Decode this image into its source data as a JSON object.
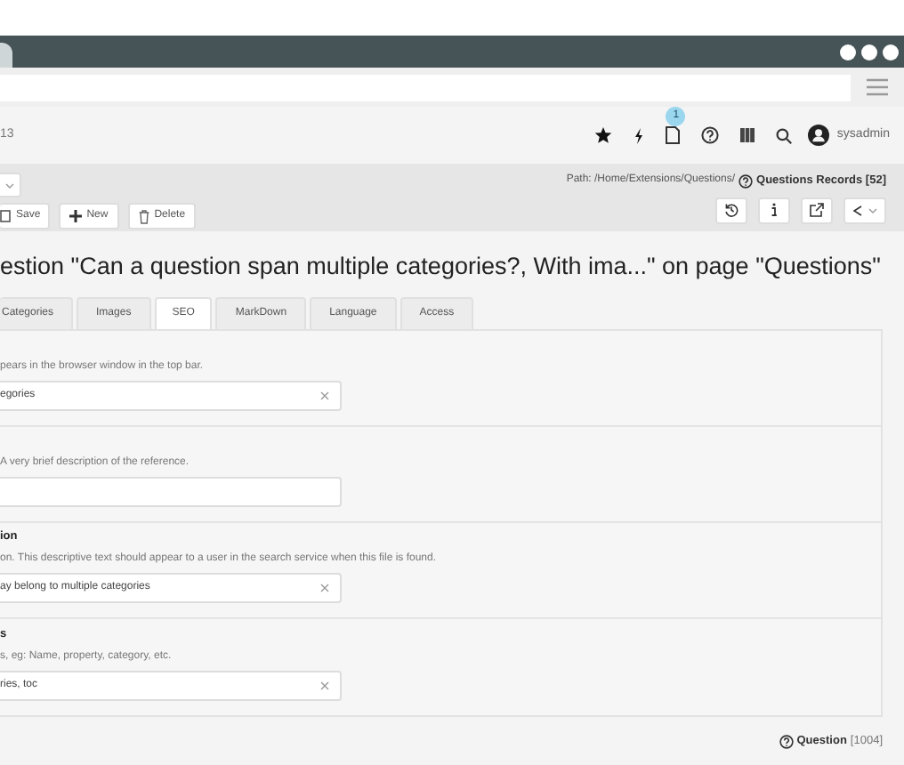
{
  "header": {
    "breadcrumb": "13",
    "notification_count": "1",
    "user": "sysadmin"
  },
  "toolbar": {
    "buttons": [
      {
        "kind": "save",
        "label": "Save"
      },
      {
        "kind": "new",
        "label": "New"
      },
      {
        "kind": "delete",
        "label": "Delete"
      }
    ],
    "path": "Path: /Home/Extensions/Questions/",
    "records": "Questions Records [52]"
  },
  "title": "estion \"Can a question span multiple categories?, With ima...\" on page \"Questions\"",
  "tabs": [
    {
      "label": "Categories",
      "selected": false
    },
    {
      "label": "Images",
      "selected": false
    },
    {
      "label": "SEO",
      "selected": true
    },
    {
      "label": "MarkDown",
      "selected": false
    },
    {
      "label": "Language",
      "selected": false
    },
    {
      "label": "Access",
      "selected": false
    }
  ],
  "fields": [
    {
      "hint": "pears in the browser window in the top bar.",
      "value": "egories"
    },
    {
      "hint": "A very brief description of the reference."
    },
    {
      "label": "ion",
      "hint": "on. This descriptive text should appear to a user in the search service when this file is found.",
      "value": "ay belong to multiple categories"
    },
    {
      "label": "s",
      "hint": "s, eg: Name, property, category, etc.",
      "value": "ries, toc"
    }
  ],
  "footer": {
    "type": "Question",
    "id": "[1004]"
  }
}
